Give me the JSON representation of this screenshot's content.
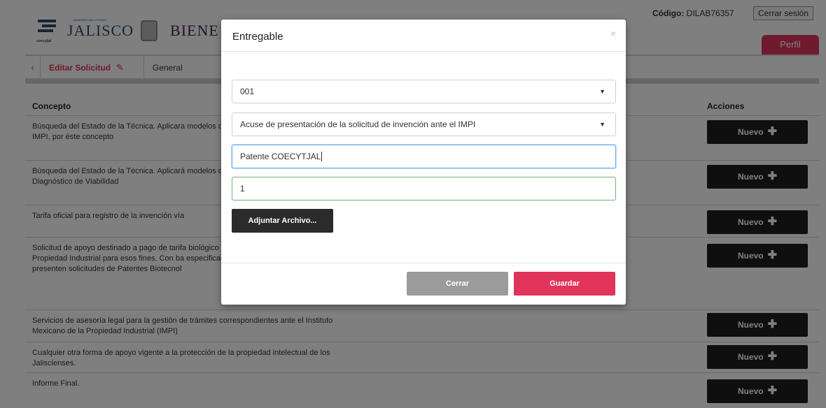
{
  "header": {
    "logo_text": "JALISCO",
    "logo_caption": "GOBIERNO DEL ESTADO",
    "logo_mark_caption": "coecytjal",
    "bienestar_text": "BIENE",
    "codigo_label": "Código:",
    "codigo_value": "DILAB76357",
    "logout_label": "Cerrar sesión",
    "perfil_label": "Perfil"
  },
  "subnav": {
    "back_icon": "chevron-left-icon",
    "edit_label": "Editar Solicitud",
    "pencil_icon": "pencil-icon",
    "tab_general": "General"
  },
  "table": {
    "col_concepto": "Concepto",
    "col_acciones": "Acciones",
    "new_label": "Nuevo",
    "rows": [
      {
        "text": "Búsqueda del Estado de la Técnica. Aplicara modelos de utilidad. a) Solicitar apoyo para p IMPI, por éste concepto"
      },
      {
        "text": "Búsqueda del Estado de la Técnica. Aplicará modelos de utilidad b) Solicitar apoyo para p Diagnóstico de Viabilidad"
      },
      {
        "text": "Tarifa oficial para registro de la invención vía"
      },
      {
        "text": "Solicitud de apoyo destinado a pago de tarifa biológico en instituciones reconocidas por el Propiedad Industrial para esos fines. Con ba especificaciones establecidas en el inciso g) presenten solicitudes de Patentes Biotecnol"
      },
      {
        "text": "Servicios de asesoría legal para la gestión de trámites correspondientes ante el Instituto Mexicano de la Propiedad Industrial (IMPI)"
      },
      {
        "text": "Cualquier otra forma de apoyo vigente a la protección de la propiedad intelectual de los Jaliscienses."
      },
      {
        "text": "Informe Final."
      }
    ]
  },
  "modal": {
    "title": "Entregable",
    "close_glyph": "×",
    "select_1_value": "001",
    "select_2_value": "Acuse de presentación de la solicitud de invención ante el IMPI",
    "text_field_value": "Patente COECYTJAL",
    "number_field_value": "1",
    "attach_label": "Adjuntar Archivo...",
    "cerrar_label": "Cerrar",
    "guardar_label": "Guardar"
  },
  "colors": {
    "accent": "#e1345a",
    "dark_button": "#1e1e1e",
    "brand_blue": "#2a4b6a"
  }
}
